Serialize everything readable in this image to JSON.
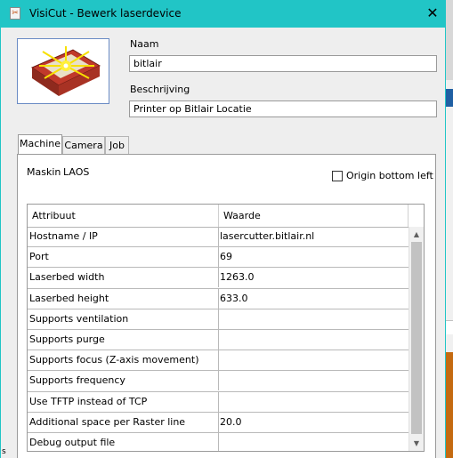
{
  "window": {
    "title": "VisiCut - Bewerk laserdevice",
    "close_glyph": "✕",
    "app_icon_glyph": "✂"
  },
  "device": {
    "name_label": "Naam",
    "name_value": "bitlair",
    "description_label": "Beschrijving",
    "description_value": "Printer op Bitlair Locatie"
  },
  "tabs": [
    {
      "label": "Machine",
      "active": true
    },
    {
      "label": "Camera",
      "active": false
    },
    {
      "label": "Job",
      "active": false
    }
  ],
  "machine": {
    "maskin_label": "Maskin",
    "maskin_value": "LAOS",
    "origin_label": "Origin bottom left",
    "origin_checked": false
  },
  "table": {
    "headers": [
      "Attribuut",
      "Waarde"
    ],
    "rows": [
      {
        "key": "Hostname / IP",
        "value": "lasercutter.bitlair.nl",
        "type": "text"
      },
      {
        "key": "Port",
        "value": "69",
        "type": "text"
      },
      {
        "key": "Laserbed width",
        "value": "1263.0",
        "type": "text"
      },
      {
        "key": "Laserbed height",
        "value": "633.0",
        "type": "text"
      },
      {
        "key": "Supports ventilation",
        "value": "",
        "type": "check",
        "checked": false
      },
      {
        "key": "Supports purge",
        "value": "",
        "type": "check",
        "checked": false
      },
      {
        "key": "Supports focus (Z-axis movement)",
        "value": "",
        "type": "check",
        "checked": false
      },
      {
        "key": "Supports frequency",
        "value": "",
        "type": "check",
        "checked": true
      },
      {
        "key": "Use TFTP instead of TCP",
        "value": "",
        "type": "check",
        "checked": true
      },
      {
        "key": "Additional space per Raster line",
        "value": "20.0",
        "type": "text"
      },
      {
        "key": "Debug output file",
        "value": "",
        "type": "text"
      }
    ]
  },
  "corner_text": "s",
  "colors": {
    "titlebar": "#21c5c6",
    "selection_border": "#6a8bc4"
  }
}
